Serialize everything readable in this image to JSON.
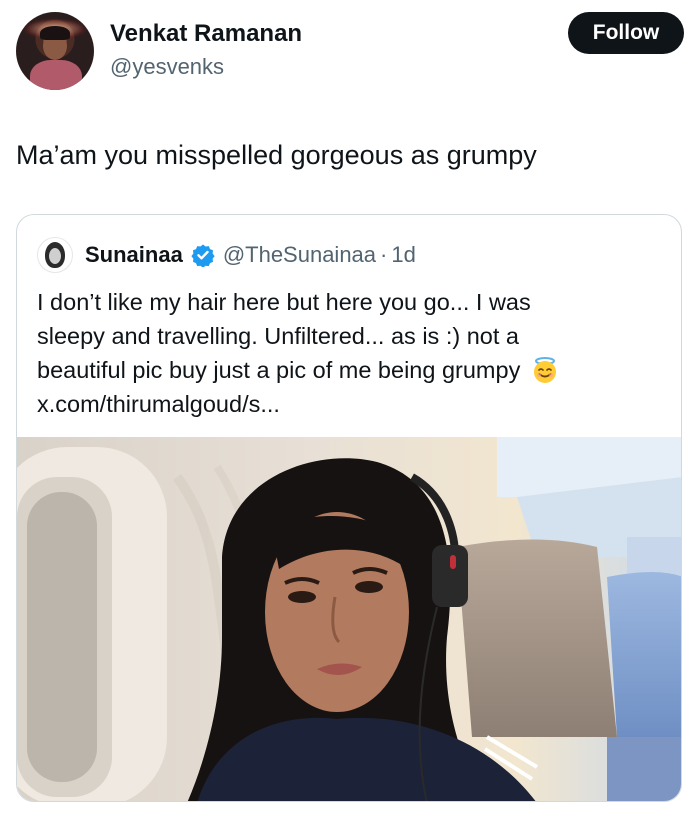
{
  "header": {
    "display_name": "Venkat Ramanan",
    "handle": "@yesvenks",
    "follow_label": "Follow"
  },
  "tweet": {
    "text": "Ma’am you misspelled gorgeous as grumpy"
  },
  "quoted_tweet": {
    "display_name": "Sunainaa",
    "handle": "@TheSunainaa",
    "separator": "·",
    "time": "1d",
    "text_lines": [
      "I don’t like my hair here but here you go... I was",
      "sleepy and travelling. Unfiltered... as is :) not a",
      "beautiful pic buy just a pic of me being grumpy"
    ],
    "link": "x.com/thirumalgoud/s...",
    "emoji_name": "smiling-face-with-halo-icon",
    "verified_color": "#1d9bf0"
  },
  "colors": {
    "text": "#0f1419",
    "secondary": "#536471",
    "border": "#cfd9de",
    "follow_bg": "#0f1419"
  }
}
